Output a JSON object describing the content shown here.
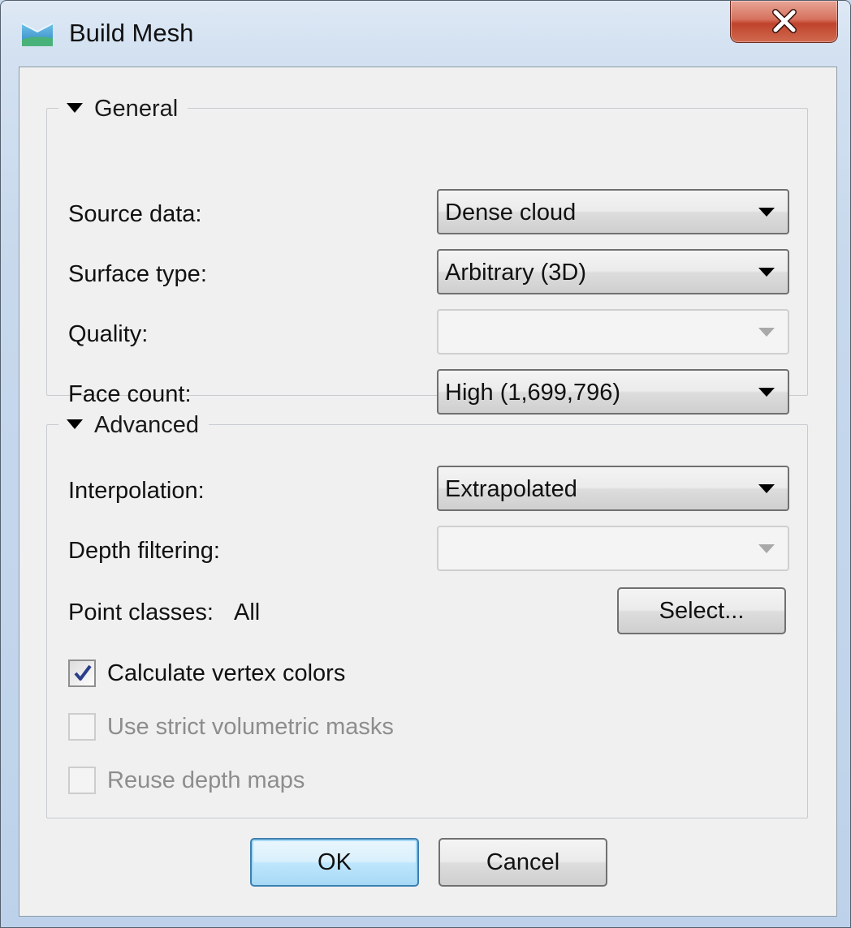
{
  "window": {
    "title": "Build Mesh",
    "icon": "build-mesh-app-icon",
    "close_icon": "close-x-icon"
  },
  "general": {
    "title": "General",
    "source_data": {
      "label": "Source data:",
      "value": "Dense cloud"
    },
    "surface_type": {
      "label": "Surface type:",
      "value": "Arbitrary (3D)"
    },
    "quality": {
      "label": "Quality:",
      "value": ""
    },
    "face_count": {
      "label": "Face count:",
      "value": "High (1,699,796)"
    }
  },
  "advanced": {
    "title": "Advanced",
    "interpolation": {
      "label": "Interpolation:",
      "value": "Extrapolated"
    },
    "depth_filtering": {
      "label": "Depth filtering:",
      "value": ""
    },
    "point_classes": {
      "label": "Point classes:",
      "value": "All",
      "button": "Select..."
    },
    "calculate_vertex_colors": {
      "label": "Calculate vertex colors",
      "checked": true,
      "enabled": true
    },
    "use_strict_volumetric_masks": {
      "label": "Use strict volumetric masks",
      "checked": false,
      "enabled": false
    },
    "reuse_depth_maps": {
      "label": "Reuse depth maps",
      "checked": false,
      "enabled": false
    }
  },
  "footer": {
    "ok": "OK",
    "cancel": "Cancel"
  },
  "colors": {
    "close_button": "#c7472f",
    "default_button_border": "#3c7fb1",
    "checkmark": "#2a3e8a",
    "disabled_text": "#8d8d8d"
  }
}
